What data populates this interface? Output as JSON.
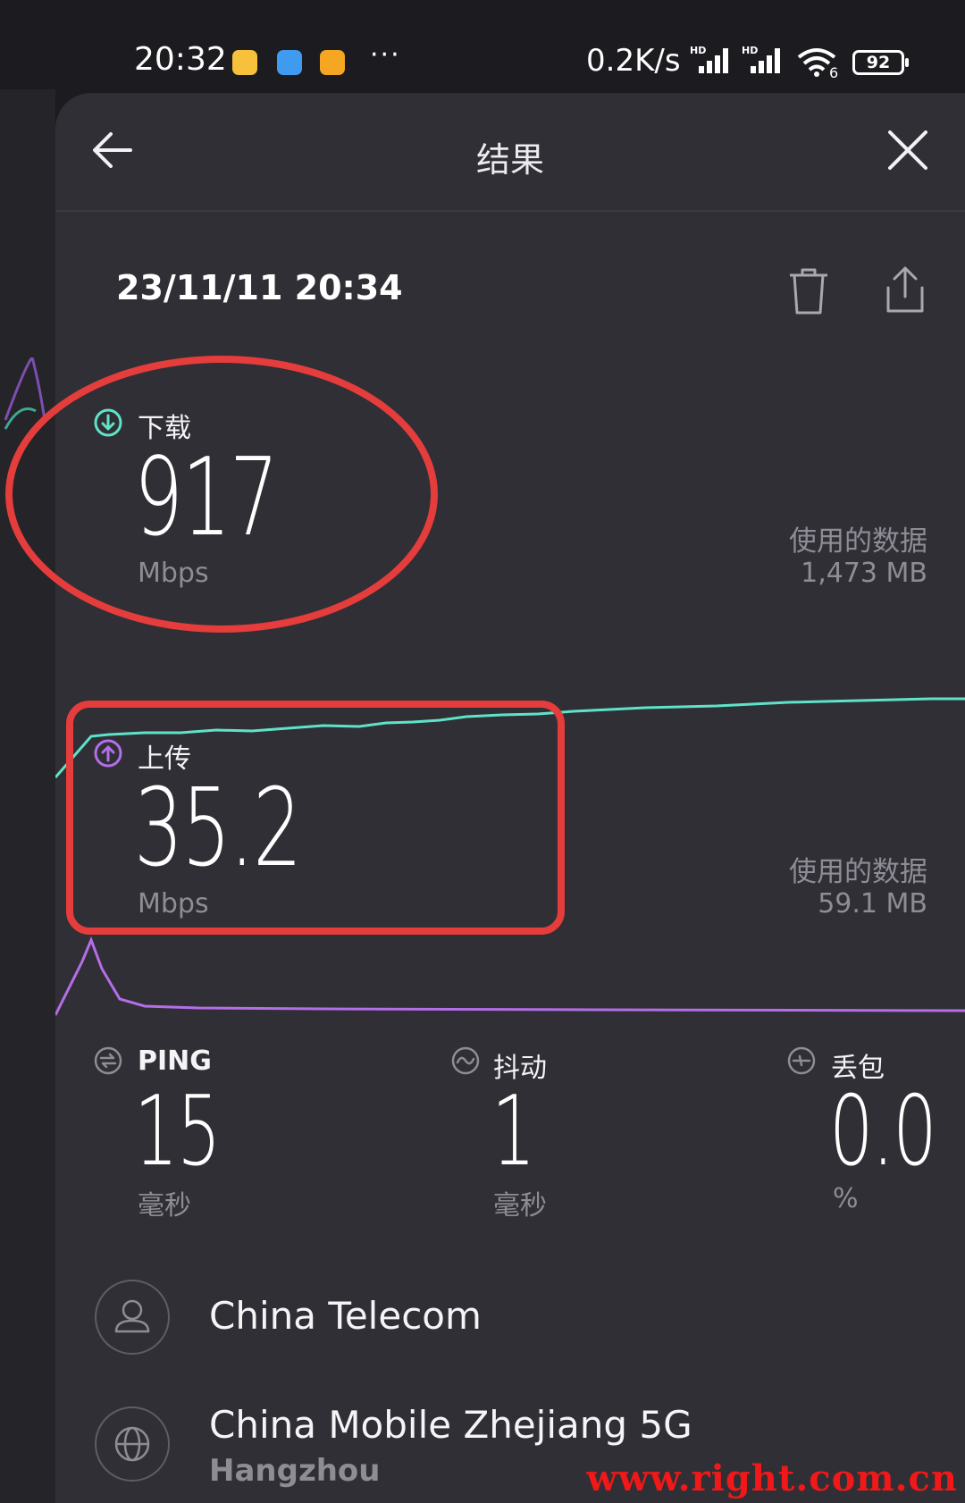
{
  "status_bar": {
    "time": "20:32",
    "net_speed": "0.2K/s",
    "network_badge": "HD",
    "wifi_badge": "6",
    "battery": "92"
  },
  "header": {
    "title": "结果"
  },
  "result": {
    "datetime": "23/11/11 20:34"
  },
  "download": {
    "label": "下载",
    "value": "917",
    "unit": "Mbps",
    "data_used_label": "使用的数据",
    "data_used_value": "1,473 MB"
  },
  "upload": {
    "label": "上传",
    "value": "35.2",
    "unit": "Mbps",
    "data_used_label": "使用的数据",
    "data_used_value": "59.1 MB"
  },
  "ping": {
    "label": "PING",
    "value": "15",
    "unit": "毫秒"
  },
  "jitter": {
    "label": "抖动",
    "value": "1",
    "unit": "毫秒"
  },
  "loss": {
    "label": "丢包",
    "value": "0.0",
    "unit": "%"
  },
  "provider": {
    "name": "China Telecom"
  },
  "server": {
    "name": "China Mobile Zhejiang 5G",
    "city": "Hangzhou"
  },
  "watermark": "www.right.com.cn",
  "colors": {
    "download_accent": "#5fe3c8",
    "upload_accent": "#b46ee8",
    "annotation": "#e53c3c"
  }
}
